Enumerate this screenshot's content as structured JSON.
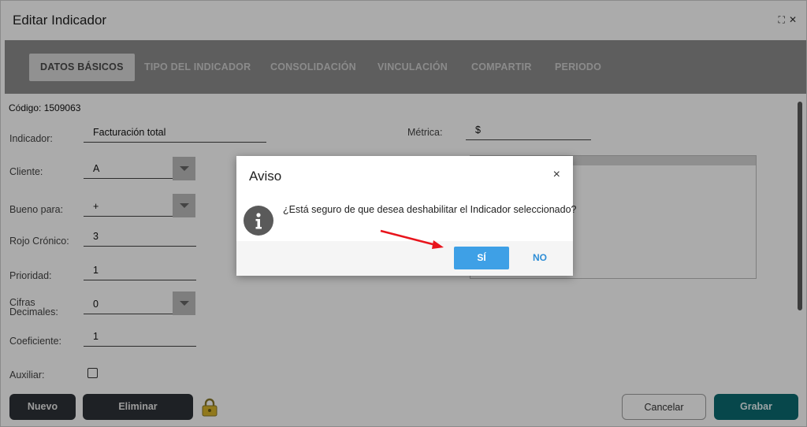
{
  "window": {
    "title": "Editar Indicador",
    "maximize_glyph": "⛶",
    "close_glyph": "✕"
  },
  "tabs": [
    {
      "label": "DATOS BÁSICOS",
      "active": true
    },
    {
      "label": "TIPO DEL INDICADOR",
      "active": false
    },
    {
      "label": "CONSOLIDACIÓN",
      "active": false
    },
    {
      "label": "VINCULACIÓN",
      "active": false
    },
    {
      "label": "COMPARTIR",
      "active": false
    },
    {
      "label": "PERIODO",
      "active": false
    }
  ],
  "form": {
    "code": "Código: 1509063",
    "indicador": {
      "label": "Indicador:",
      "value": "Facturación total"
    },
    "metrica": {
      "label": "Métrica:",
      "value": "$"
    },
    "cliente": {
      "label": "Cliente:",
      "value": "A"
    },
    "bueno_para": {
      "label": "Bueno para:",
      "value": "+"
    },
    "rojo_cronico": {
      "label": "Rojo Crónico:",
      "value": "3"
    },
    "prioridad": {
      "label": "Prioridad:",
      "value": "1"
    },
    "cifras_decimales": {
      "label_line1": "Cifras",
      "label_line2": "Decimales:",
      "value": "0"
    },
    "coeficiente": {
      "label": "Coeficiente:",
      "value": "1"
    },
    "auxiliar": {
      "label": "Auxiliar:",
      "checked": false
    }
  },
  "footer": {
    "nuevo": "Nuevo",
    "eliminar": "Eliminar",
    "cancelar": "Cancelar",
    "grabar": "Grabar"
  },
  "dialog": {
    "title": "Aviso",
    "close_glyph": "×",
    "message": "¿Está seguro de que desea deshabilitar el Indicador seleccionado?",
    "yes_label": "SÍ",
    "no_label": "NO",
    "icon": "info-icon"
  },
  "colors": {
    "tabs_bg": "#8c8c8c",
    "primary_dark": "#2e3238",
    "accent_teal": "#0b6a71",
    "dialog_yes": "#3ea0e6",
    "arrow_red": "#e8141c"
  }
}
